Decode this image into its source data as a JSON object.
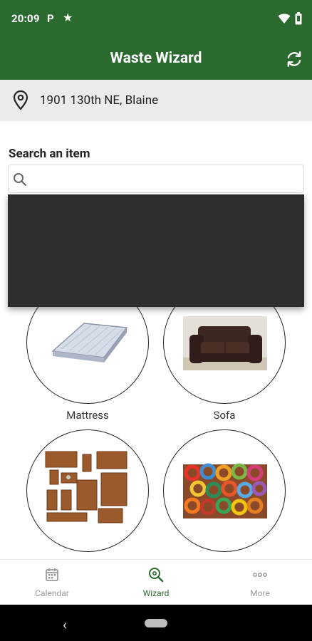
{
  "status_bar": {
    "time": "20:09",
    "p_badge": "P",
    "star": "★",
    "icons": [
      "wifi-icon",
      "battery-icon"
    ]
  },
  "app_bar": {
    "title": "Waste Wizard",
    "refresh_icon": "refresh-icon"
  },
  "address": {
    "text": "1901 130th NE, Blaine",
    "icon": "location-pin-icon"
  },
  "search": {
    "label": "Search an item",
    "placeholder": "",
    "value": ""
  },
  "items": [
    {
      "label": "Mattress"
    },
    {
      "label": "Sofa"
    },
    {
      "label": "Furniture"
    },
    {
      "label": "Rugs"
    }
  ],
  "bottom_nav": [
    {
      "label": "Calendar",
      "icon": "calendar-icon",
      "active": false
    },
    {
      "label": "Wizard",
      "icon": "wizard-search-icon",
      "active": true
    },
    {
      "label": "More",
      "icon": "more-icon",
      "active": false
    }
  ],
  "colors": {
    "brand_green": "#2a6a2e",
    "dropdown_bg": "#2d2d2d"
  }
}
